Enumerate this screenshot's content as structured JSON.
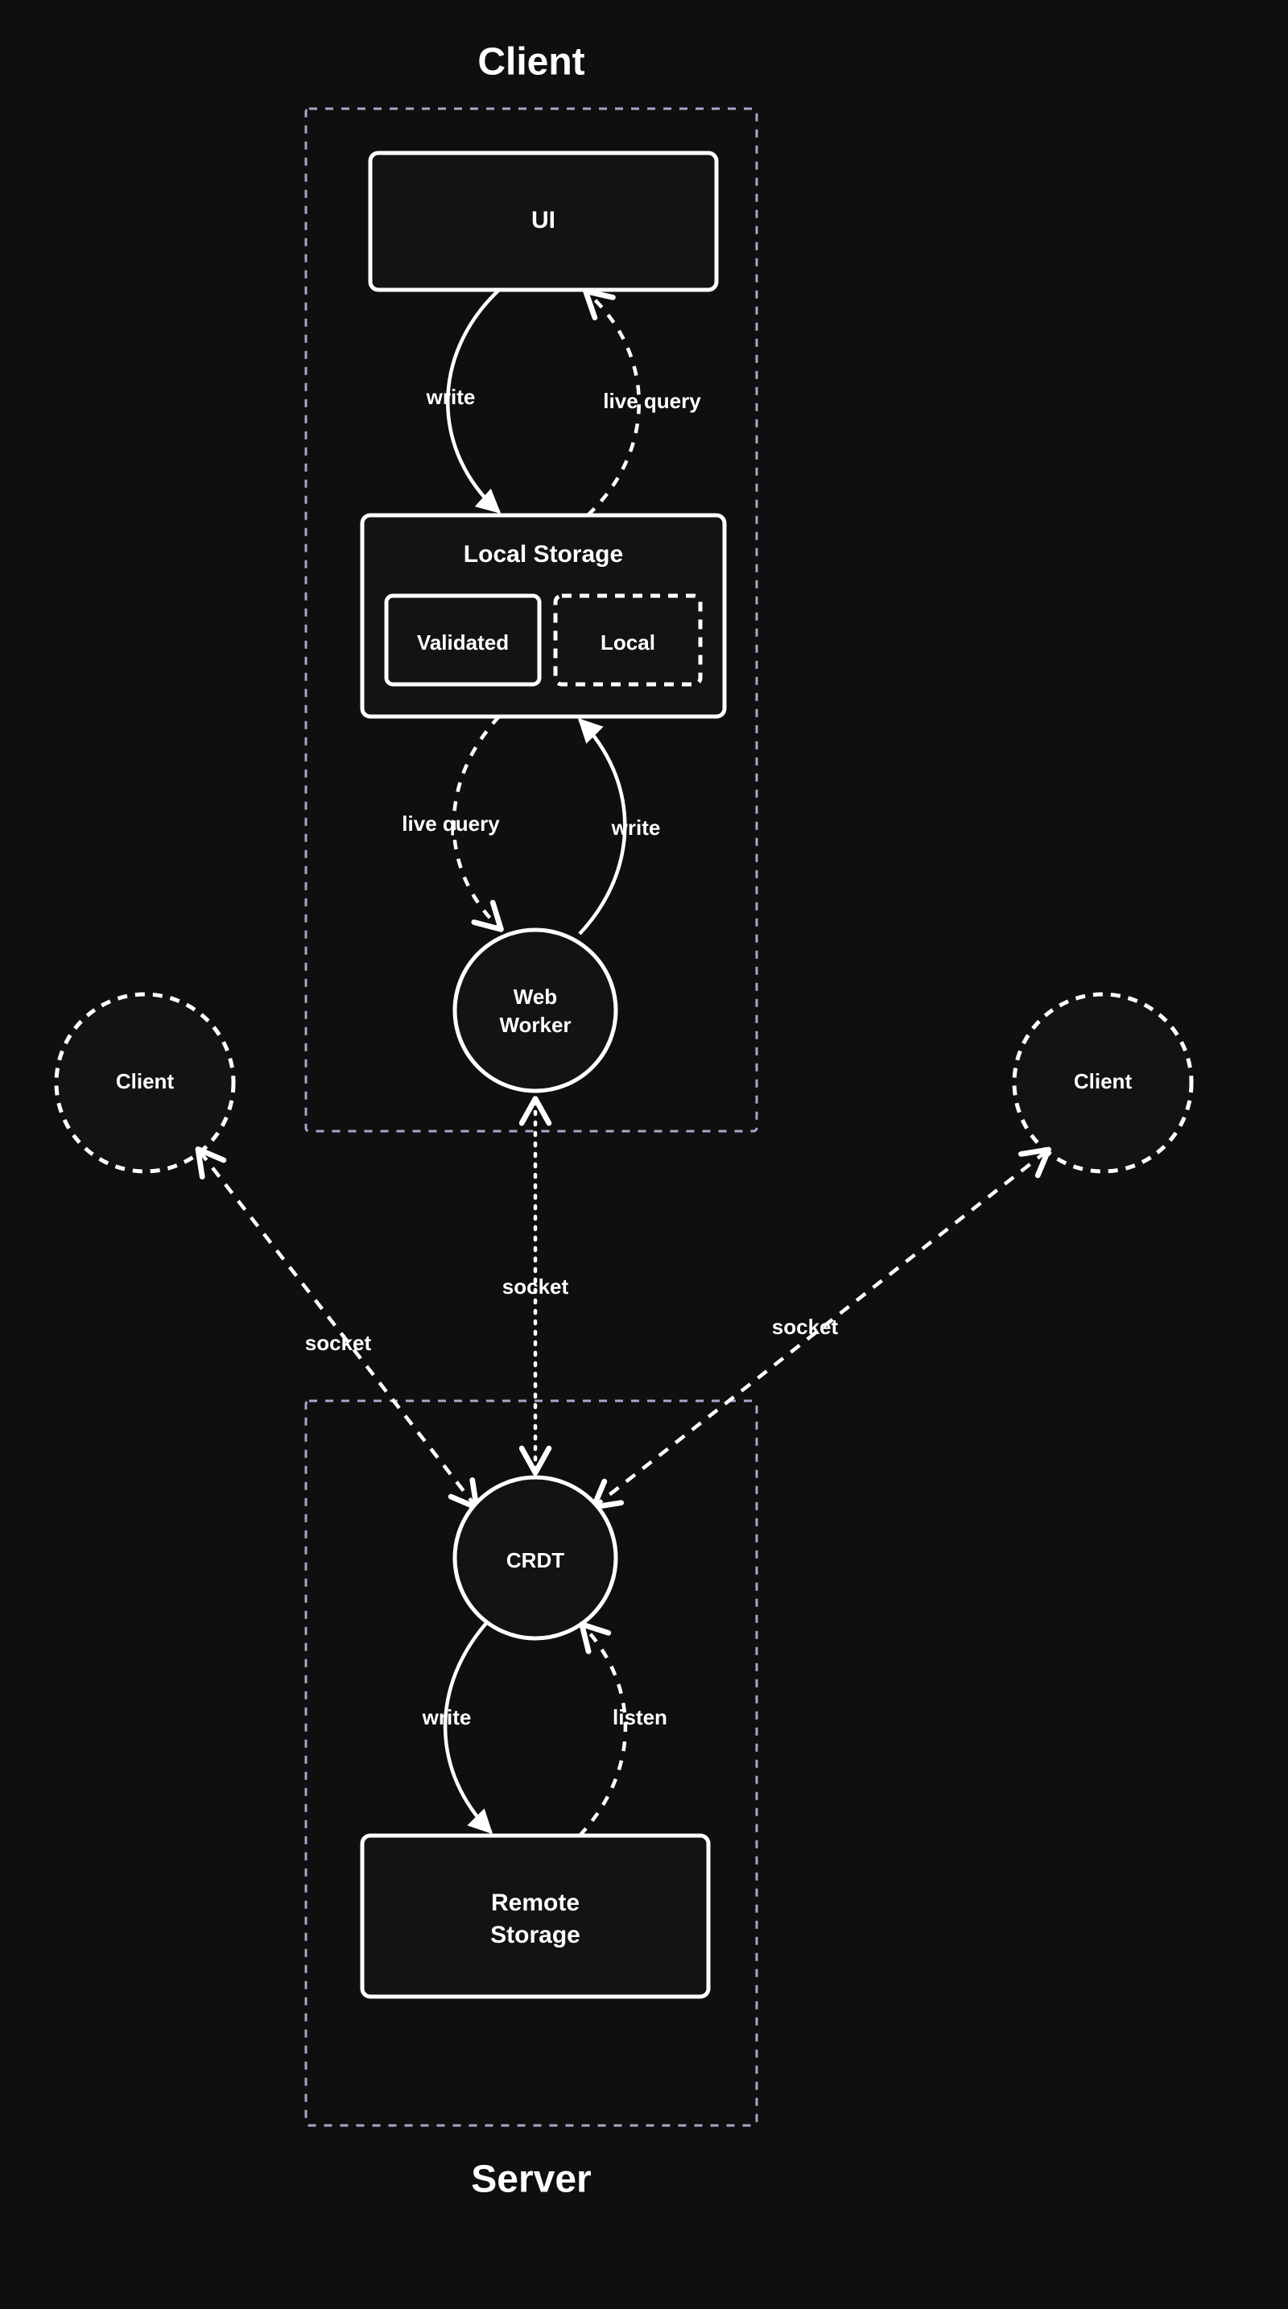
{
  "titles": {
    "client": "Client",
    "server": "Server"
  },
  "nodes": {
    "ui": "UI",
    "local_storage": "Local Storage",
    "validated": "Validated",
    "local": "Local",
    "web_worker_l1": "Web",
    "web_worker_l2": "Worker",
    "crdt": "CRDT",
    "remote_storage_l1": "Remote",
    "remote_storage_l2": "Storage",
    "client_left": "Client",
    "client_right": "Client"
  },
  "edges": {
    "write": "write",
    "live_query": "live query",
    "socket": "socket",
    "listen": "listen"
  },
  "colors": {
    "bg": "#0f0f0f",
    "accent": "#aaa6c9",
    "stroke": "#ffffff",
    "fill": "#131313"
  }
}
